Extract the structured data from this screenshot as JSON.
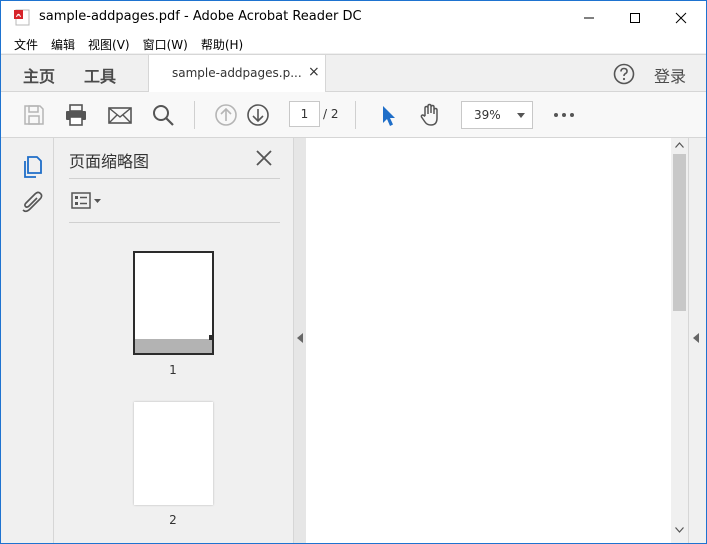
{
  "window": {
    "title": "sample-addpages.pdf - Adobe Acrobat Reader DC",
    "app_icon": "acrobat-pdf-icon"
  },
  "menu": {
    "items": [
      "文件",
      "编辑",
      "视图(V)",
      "窗口(W)",
      "帮助(H)"
    ]
  },
  "tabs": {
    "home": "主页",
    "tools": "工具",
    "document": "sample-addpages.p...",
    "close": "×",
    "login": "登录"
  },
  "toolbar": {
    "current_page": "1",
    "total_pages": "/ 2",
    "zoom": "39%"
  },
  "panel": {
    "title": "页面缩略图",
    "thumbnails": [
      {
        "label": "1",
        "selected": true
      },
      {
        "label": "2",
        "selected": false
      }
    ]
  },
  "colors": {
    "accent": "#1e73d0",
    "pdf_red": "#d6242a",
    "select_blue": "#1f6ec8"
  }
}
